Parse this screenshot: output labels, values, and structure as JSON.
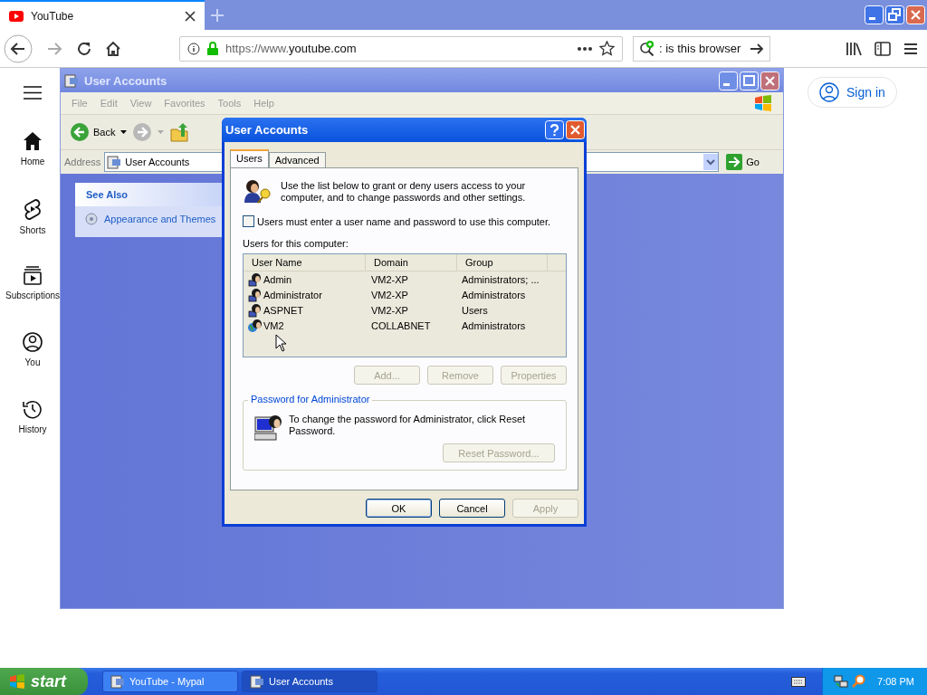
{
  "browser": {
    "tab_title": "YouTube",
    "url_prefix": "https://www.",
    "url_host": "youtube.com",
    "search": ": is this browser"
  },
  "youtube": {
    "nav": [
      {
        "label": "Home",
        "kind": "home"
      },
      {
        "label": "Shorts",
        "kind": "shorts"
      },
      {
        "label": "Subscriptions",
        "kind": "subscriptions"
      },
      {
        "label": "You",
        "kind": "you"
      },
      {
        "label": "History",
        "kind": "history"
      }
    ],
    "sign_in": "Sign in"
  },
  "explorer": {
    "title": "User Accounts",
    "menu": [
      "File",
      "Edit",
      "View",
      "Favorites",
      "Tools",
      "Help"
    ],
    "back": "Back",
    "address_label": "Address",
    "address": "User Accounts",
    "go": "Go",
    "see_also": {
      "title": "See Also",
      "items": [
        "Appearance and Themes"
      ]
    }
  },
  "dialog": {
    "title": "User Accounts",
    "tabs": [
      {
        "label": "Users",
        "selected": true
      },
      {
        "label": "Advanced",
        "selected": false
      }
    ],
    "intro": "Use the list below to grant or deny users access to your computer, and to change passwords and other settings.",
    "require_password": {
      "label": "Users must enter a user name and password to use this computer.",
      "checked": false
    },
    "list_label": "Users for this computer:",
    "columns": [
      "User Name",
      "Domain",
      "Group"
    ],
    "rows": [
      {
        "user": "Admin",
        "domain": "VM2-XP",
        "group": "Administrators; ...",
        "kind": "local"
      },
      {
        "user": "Administrator",
        "domain": "VM2-XP",
        "group": "Administrators",
        "kind": "local"
      },
      {
        "user": "ASPNET",
        "domain": "VM2-XP",
        "group": "Users",
        "kind": "local"
      },
      {
        "user": "VM2",
        "domain": "COLLABNET",
        "group": "Administrators",
        "kind": "domain"
      }
    ],
    "actions": [
      {
        "label": "Add...",
        "disabled": true
      },
      {
        "label": "Remove",
        "disabled": true
      },
      {
        "label": "Properties",
        "disabled": true
      }
    ],
    "password_group": {
      "title": "Password for Administrator",
      "text": "To change the password for Administrator, click Reset Password.",
      "button": {
        "label": "Reset Password...",
        "disabled": true
      }
    },
    "buttons": [
      {
        "label": "OK",
        "disabled": false
      },
      {
        "label": "Cancel",
        "disabled": false
      },
      {
        "label": "Apply",
        "disabled": true
      }
    ]
  },
  "taskbar": {
    "start": "start",
    "tasks": [
      {
        "label": "YouTube - Mypal",
        "selected": false
      },
      {
        "label": "User Accounts",
        "selected": true
      }
    ],
    "clock": "7:08 PM"
  }
}
